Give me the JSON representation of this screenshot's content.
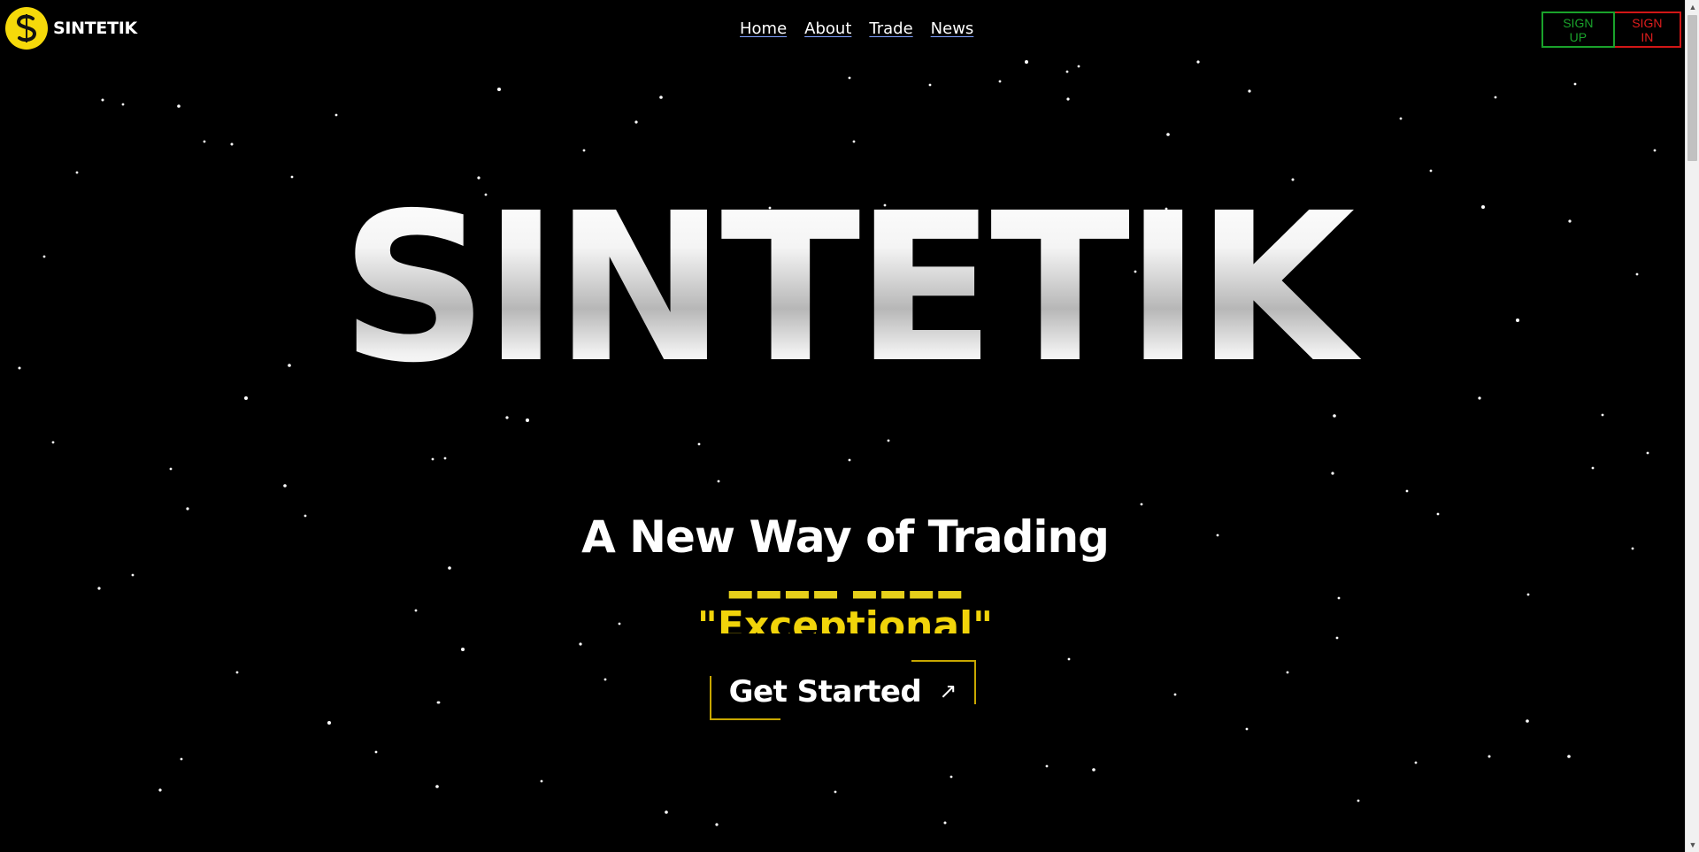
{
  "brand": {
    "name": "SINTETIK",
    "logo_icon": "s-coin-logo-icon",
    "logo_color": "#f5d90a"
  },
  "nav": {
    "items": [
      "Home",
      "About",
      "Trade",
      "News"
    ]
  },
  "auth": {
    "signup": "SIGN UP",
    "signin": "SIGN IN",
    "signup_color": "#1aa22b",
    "signin_color": "#e11d1d"
  },
  "hero": {
    "title": "SINTETIK",
    "tagline": "A New Way of Trading",
    "rotating_word": "\"Exceptional\"",
    "cta_label": "Get Started",
    "cta_icon": "arrow-up-right-icon",
    "accent_color": "#f1d40a"
  }
}
